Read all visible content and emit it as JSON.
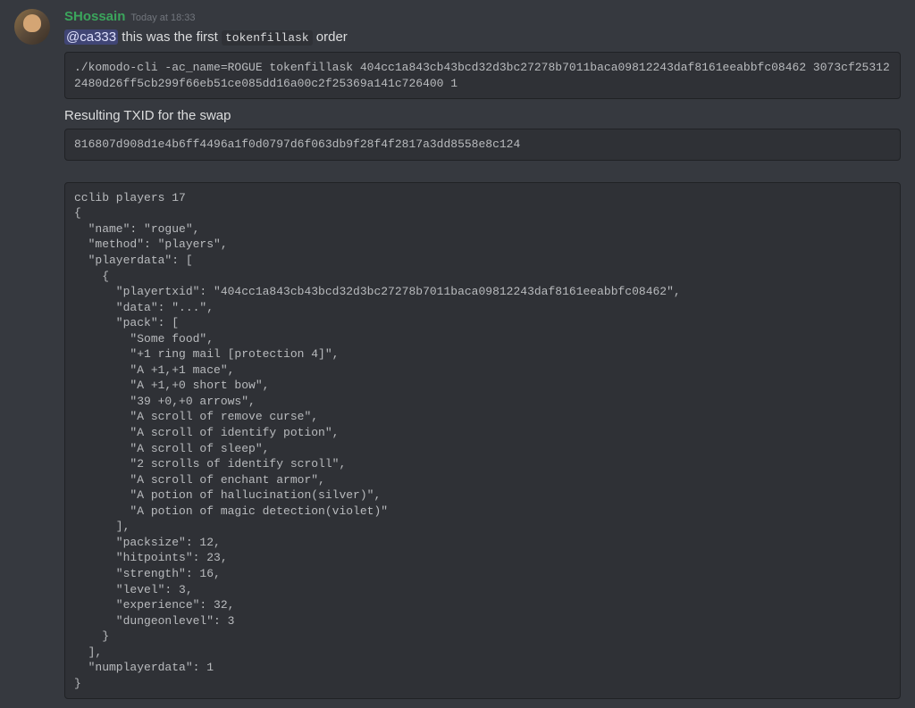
{
  "message": {
    "username": "SHossain",
    "timestamp": "Today at 18:33",
    "mention": "@ca333",
    "text_part1": " this was the first ",
    "inline_code": "tokenfillask",
    "text_part2": " order",
    "code_block_1": "./komodo-cli -ac_name=ROGUE tokenfillask 404cc1a843cb43bcd32d3bc27278b7011baca09812243daf8161eeabbfc08462 3073cf253122480d26ff5cb299f66eb51ce085dd16a00c2f25369a141c726400 1",
    "sub_text": "Resulting TXID for the swap",
    "code_block_2": "816807d908d1e4b6ff4496a1f0d0797d6f063db9f28f4f2817a3dd8558e8c124",
    "code_block_3": "cclib players 17\n{\n  \"name\": \"rogue\",\n  \"method\": \"players\",\n  \"playerdata\": [\n    {\n      \"playertxid\": \"404cc1a843cb43bcd32d3bc27278b7011baca09812243daf8161eeabbfc08462\",\n      \"data\": \"...\",\n      \"pack\": [\n        \"Some food\",\n        \"+1 ring mail [protection 4]\",\n        \"A +1,+1 mace\",\n        \"A +1,+0 short bow\",\n        \"39 +0,+0 arrows\",\n        \"A scroll of remove curse\",\n        \"A scroll of identify potion\",\n        \"A scroll of sleep\",\n        \"2 scrolls of identify scroll\",\n        \"A scroll of enchant armor\",\n        \"A potion of hallucination(silver)\",\n        \"A potion of magic detection(violet)\"\n      ],\n      \"packsize\": 12,\n      \"hitpoints\": 23,\n      \"strength\": 16,\n      \"level\": 3,\n      \"experience\": 32,\n      \"dungeonlevel\": 3\n    }\n  ],\n  \"numplayerdata\": 1\n}"
  }
}
